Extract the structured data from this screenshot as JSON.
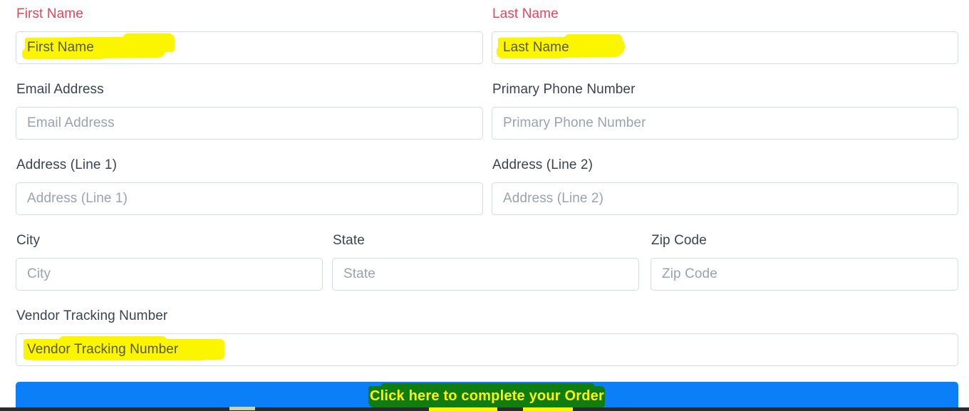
{
  "form": {
    "rows": [
      {
        "row_name": "name-row",
        "fields": [
          {
            "name": "first-name",
            "label": "First Name",
            "placeholder": "First Name",
            "required": true,
            "highlighted": true
          },
          {
            "name": "last-name",
            "label": "Last Name",
            "placeholder": "Last Name",
            "required": true,
            "highlighted": true
          }
        ]
      },
      {
        "row_name": "contact-row",
        "fields": [
          {
            "name": "email-address",
            "label": "Email Address",
            "placeholder": "Email Address",
            "required": false,
            "highlighted": false
          },
          {
            "name": "primary-phone-number",
            "label": "Primary Phone Number",
            "placeholder": "Primary Phone Number",
            "required": false,
            "highlighted": false
          }
        ]
      },
      {
        "row_name": "address-row",
        "fields": [
          {
            "name": "address-line-1",
            "label": "Address (Line 1)",
            "placeholder": "Address (Line 1)",
            "required": false,
            "highlighted": false
          },
          {
            "name": "address-line-2",
            "label": "Address (Line 2)",
            "placeholder": "Address (Line 2)",
            "required": false,
            "highlighted": false
          }
        ]
      },
      {
        "row_name": "city-state-zip-row",
        "fields": [
          {
            "name": "city",
            "label": "City",
            "placeholder": "City",
            "required": false,
            "highlighted": false
          },
          {
            "name": "state",
            "label": "State",
            "placeholder": "State",
            "required": false,
            "highlighted": false
          },
          {
            "name": "zip-code",
            "label": "Zip Code",
            "placeholder": "Zip Code",
            "required": false,
            "highlighted": false
          }
        ]
      },
      {
        "row_name": "vendor-row",
        "fields": [
          {
            "name": "vendor-tracking-number",
            "label": "Vendor Tracking Number",
            "placeholder": "Vendor Tracking Number",
            "required": false,
            "highlighted": true
          }
        ]
      }
    ]
  },
  "submit": {
    "label": "Click here to complete your Order"
  },
  "colors": {
    "required_label": "#e8445a",
    "label": "#3c4350",
    "placeholder": "#9aa3b0",
    "field_border": "#d6dbe3",
    "submit_background": "#0b7ff7",
    "submit_text": "#fcf500",
    "highlight_yellow": "#fcf500",
    "highlight_green": "#0f7d0f",
    "page_background": "#ffffff"
  }
}
